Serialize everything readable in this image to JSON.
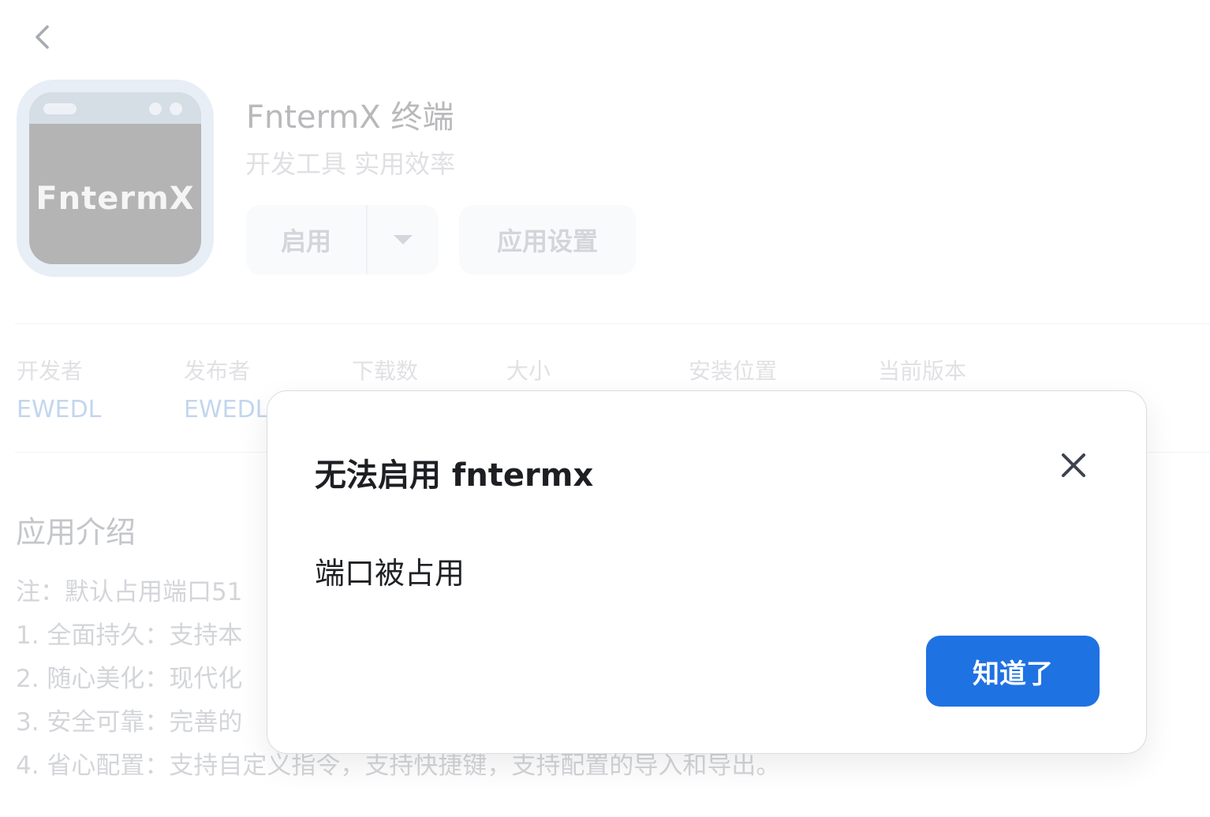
{
  "nav": {
    "back_icon": "chevron-left-icon"
  },
  "app": {
    "icon_text": "FntermX",
    "title": "FntermX 终端",
    "category": "开发工具 实用效率"
  },
  "actions": {
    "enable_label": "启用",
    "dropdown_icon": "caret-down-icon",
    "settings_label": "应用设置"
  },
  "meta": [
    {
      "label": "开发者",
      "value": "EWEDL"
    },
    {
      "label": "发布者",
      "value": "EWEDL"
    },
    {
      "label": "下载数",
      "value": ""
    },
    {
      "label": "大小",
      "value": ""
    },
    {
      "label": "安装位置",
      "value": ""
    },
    {
      "label": "当前版本",
      "value": ""
    }
  ],
  "intro": {
    "title": "应用介绍",
    "lines": [
      "注：默认占用端口51",
      "1. 全面持久：支持本",
      "2. 随心美化：现代化",
      "3. 安全可靠：完善的",
      "4. 省心配置：支持自定义指令，支持快捷键，支持配置的导入和导出。"
    ]
  },
  "dialog": {
    "title": "无法启用 fntermx",
    "message": "端口被占用",
    "ok_label": "知道了",
    "close_icon": "close-icon"
  },
  "colors": {
    "primary": "#1f72e2",
    "dialog_title": "#1d1f22",
    "muted_text": "#d3d5d9",
    "link_value": "#c3d6ef"
  }
}
